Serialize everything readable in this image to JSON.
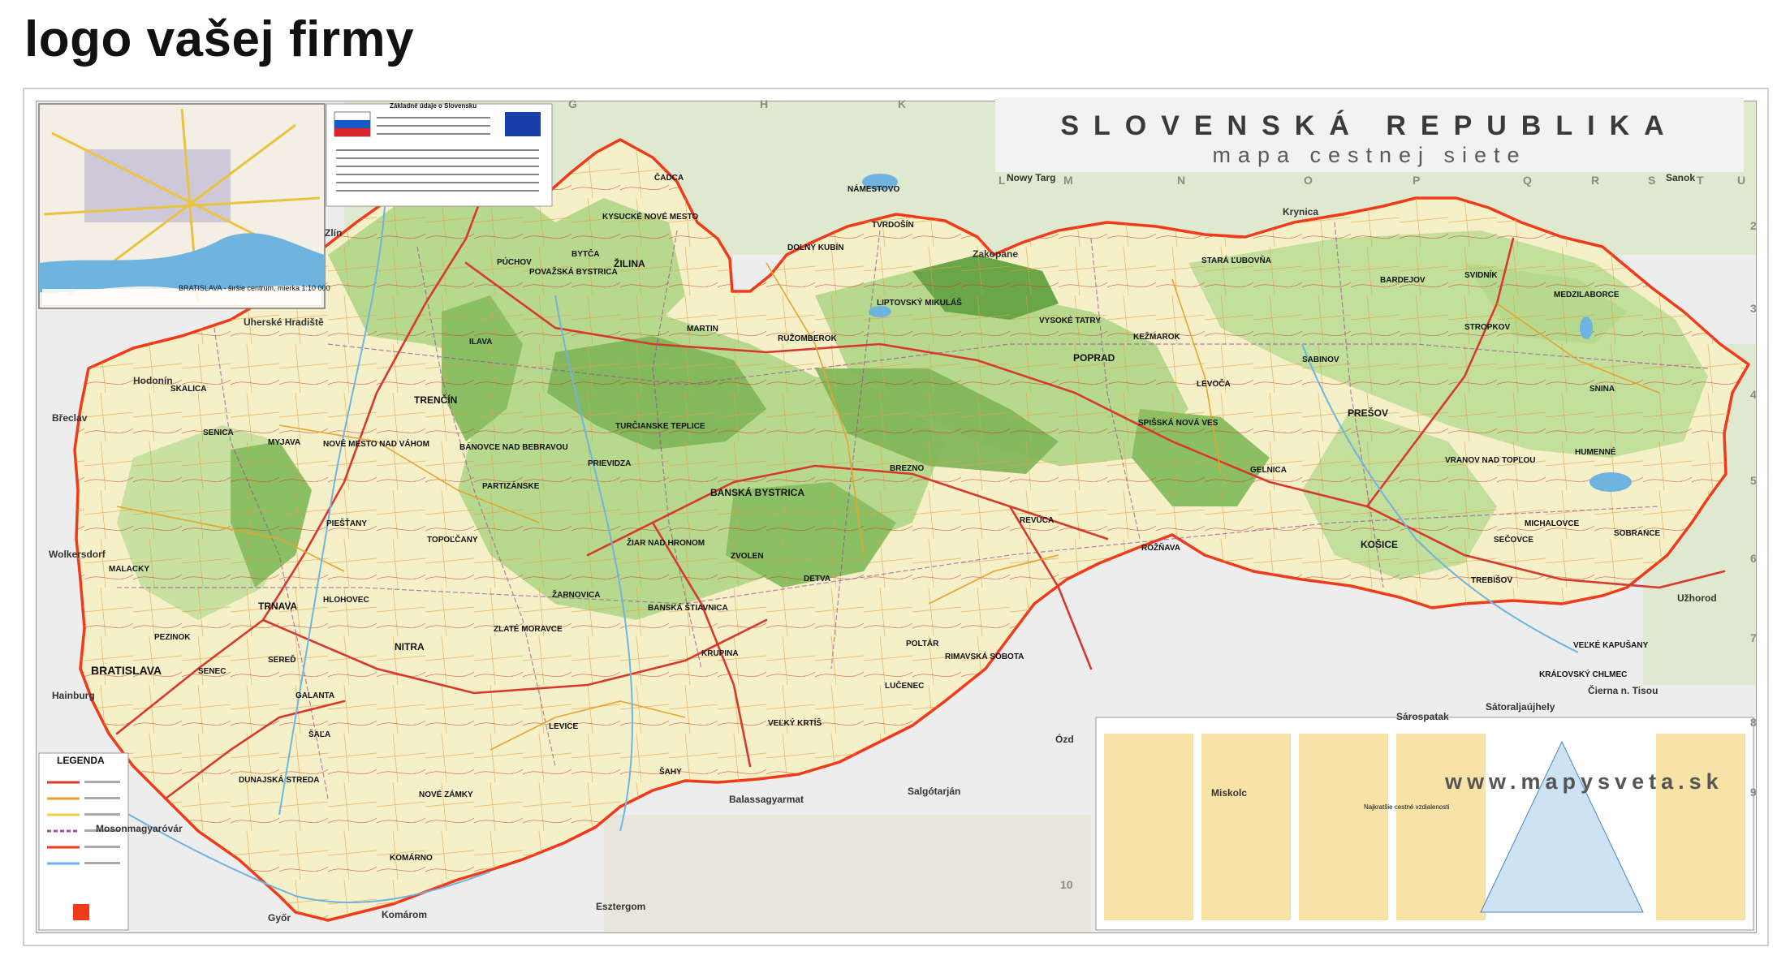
{
  "logo_text": "logo vašej firmy",
  "map": {
    "title": "SLOVENSKÁ REPUBLIKA",
    "subtitle": "mapa cestnej siete",
    "website": "www.mapysveta.sk",
    "inset_caption": "BRATISLAVA - širšie centrum, mierka 1:10 000",
    "legend_title": "LEGENDA",
    "info_title": "Základné údaje o Slovensku",
    "distance_table_title": "Najkratšie cestné vzdialenosti",
    "grid_columns": [
      "G",
      "H",
      "K",
      "L",
      "M",
      "N",
      "O",
      "P",
      "Q",
      "R",
      "S",
      "T",
      "U"
    ],
    "grid_rows": [
      "2",
      "3",
      "4",
      "5",
      "6",
      "7",
      "8",
      "9",
      "10"
    ],
    "colors": {
      "border": "#f03a1a",
      "lowland": "#f6f0c8",
      "forest": "#b7d98d",
      "mountain": "#7db457",
      "water": "#6fb3e0",
      "road": "#d63a2c",
      "road_secondary": "#e5a430"
    },
    "cities": [
      "BRATISLAVA",
      "TRNAVA",
      "NITRA",
      "TRENČÍN",
      "ŽILINA",
      "BANSKÁ BYSTRICA",
      "PREŠOV",
      "KOŠICE",
      "POPRAD",
      "MARTIN",
      "PRIEVIDZA",
      "ZVOLEN",
      "MICHALOVCE",
      "LUČENEC",
      "KOMÁRNO",
      "NOVÉ ZÁMKY",
      "LEVICE",
      "TOPOĽČANY",
      "RUŽOMBEROK",
      "LIPTOVSKÝ MIKULÁŠ",
      "SPIŠSKÁ NOVÁ VES",
      "BARDEJOV",
      "HUMENNÉ",
      "SNINA",
      "ROŽŇAVA",
      "RIMAVSKÁ SOBOTA",
      "DUNAJSKÁ STREDA",
      "GALANTA",
      "SENICA",
      "SKALICA",
      "MALACKY",
      "PIEŠŤANY",
      "PÚCHOV",
      "ČADCA",
      "DOLNÝ KUBÍN",
      "NÁMESTOVO",
      "KEŽMAROK",
      "LEVOČA",
      "STARÁ ĽUBOVŇA",
      "SVIDNÍK",
      "VRANOV NAD TOPĽOU",
      "TREBIŠOV",
      "SOBRANCE",
      "MEDZILABORCE",
      "STROPKOV",
      "SABINOV",
      "GELNICA",
      "REVÚCA",
      "POLTÁR",
      "VEĽKÝ KRTÍŠ",
      "DETVA",
      "BREZNO",
      "ŽIAR NAD HRONOM",
      "BANSKÁ ŠTIAVNICA",
      "KRUPINA",
      "ZLATÉ MORAVCE",
      "PARTIZÁNSKE",
      "BÁNOVCE NAD BEBRAVOU",
      "MYJAVA",
      "NOVÉ MESTO NAD VÁHOM",
      "ILAVA",
      "POVAŽSKÁ BYSTRICA",
      "BYTČA",
      "KYSUCKÉ NOVÉ MESTO",
      "TURČIANSKE TEPLICE",
      "ŽARNOVICA",
      "ŠAĽA",
      "SENEC",
      "PEZINOK",
      "HLOHOVEC",
      "SEREĎ",
      "TVRDOŠÍN",
      "VYSOKÉ TATRY",
      "ŠAHY",
      "VEĽKÉ KAPUŠANY",
      "SEČOVCE",
      "KRÁĽOVSKÝ CHLMEC"
    ],
    "neighbors": [
      "Nowy Targ",
      "Zakopane",
      "Krynica",
      "Sanok",
      "Miskolc",
      "Ózd",
      "Salgótarján",
      "Győr",
      "Esztergom",
      "Komárom",
      "Mosonmagyaróvár",
      "Hodonín",
      "Břeclav",
      "Zlín",
      "Uherské Hradiště",
      "Užhorod",
      "Sátoraljaújhely",
      "Sárospatak",
      "Balassagyarmat",
      "Hainburg",
      "Wolkersdorf",
      "Čierna n. Tisou"
    ]
  }
}
